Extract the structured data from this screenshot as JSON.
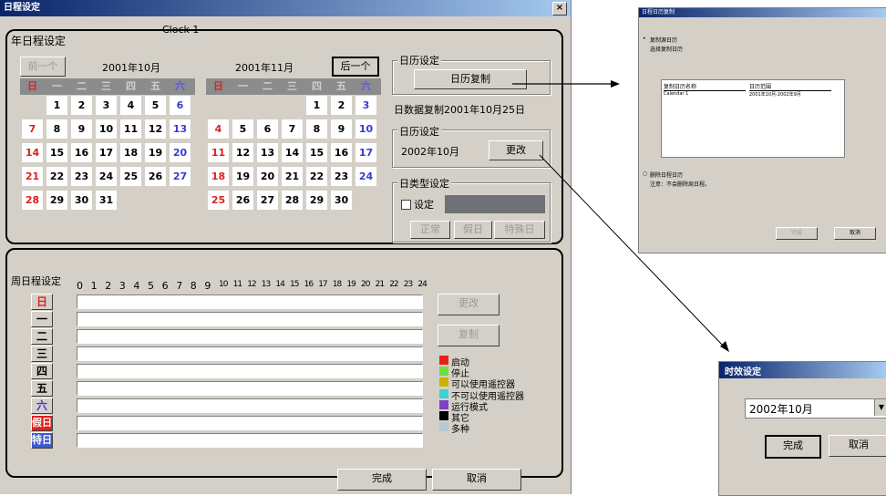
{
  "main_window": {
    "title": "日程设定",
    "close_glyph": "×",
    "clock_label": "Clock 1",
    "annual_section": {
      "label": "年日程设定",
      "prev_button": "前一个",
      "next_button": "后一个",
      "left_month_title": "2001年10月",
      "right_month_title": "2001年11月",
      "weekday_headers": [
        "日",
        "一",
        "二",
        "三",
        "四",
        "五",
        "六"
      ],
      "left_weeks": [
        [
          "",
          "1",
          "2",
          "3",
          "4",
          "5",
          "6"
        ],
        [
          "7",
          "8",
          "9",
          "10",
          "11",
          "12",
          "13"
        ],
        [
          "14",
          "15",
          "16",
          "17",
          "18",
          "19",
          "20"
        ],
        [
          "21",
          "22",
          "23",
          "24",
          "25",
          "26",
          "27"
        ],
        [
          "28",
          "29",
          "30",
          "31",
          "",
          "",
          ""
        ]
      ],
      "right_weeks": [
        [
          "",
          "",
          "",
          "",
          "1",
          "2",
          "3"
        ],
        [
          "4",
          "5",
          "6",
          "7",
          "8",
          "9",
          "10"
        ],
        [
          "11",
          "12",
          "13",
          "14",
          "15",
          "16",
          "17"
        ],
        [
          "18",
          "19",
          "20",
          "21",
          "22",
          "23",
          "24"
        ],
        [
          "25",
          "26",
          "27",
          "28",
          "29",
          "30",
          ""
        ]
      ]
    },
    "calendar_settings": {
      "group_label": "日历设定",
      "copy_button": "日历复制",
      "copy_status": "日数据复制2001年10月25日"
    },
    "calendar_setting2": {
      "group_label": "日历设定",
      "month_value": "2002年10月",
      "change_button": "更改"
    },
    "daytype_settings": {
      "group_label": "日类型设定",
      "checkbox_label": "设定",
      "normal_button": "正常",
      "holiday_button": "假日",
      "special_button": "特殊日"
    },
    "weekly_section": {
      "label": "周日程设定",
      "hours": [
        "0",
        "1",
        "2",
        "3",
        "4",
        "5",
        "6",
        "7",
        "8",
        "9",
        "10",
        "11",
        "12",
        "13",
        "14",
        "15",
        "16",
        "17",
        "18",
        "19",
        "20",
        "21",
        "22",
        "23",
        "24"
      ],
      "rows": [
        "日",
        "一",
        "二",
        "三",
        "四",
        "五",
        "六",
        "假日",
        "特日"
      ],
      "change_button": "更改",
      "copy_button": "复制",
      "legend": [
        {
          "label": "启动",
          "color": "#e8201c"
        },
        {
          "label": "停止",
          "color": "#6ce040"
        },
        {
          "label": "可以使用遥控器",
          "color": "#c8b400"
        },
        {
          "label": "不可以使用遥控器",
          "color": "#40d0d0"
        },
        {
          "label": "运行模式",
          "color": "#8040c8"
        },
        {
          "label": "其它",
          "color": "#000000"
        },
        {
          "label": "多种",
          "color": "#b8c8d0"
        }
      ]
    },
    "footer": {
      "ok_button": "完成",
      "cancel_button": "取消"
    }
  },
  "copy_dialog": {
    "title": "日程日历复制",
    "option1": "复制源日历",
    "option1_sub": "选择复制日历",
    "table_headers": [
      "复制日历名称",
      "日历范围"
    ],
    "table_row": [
      "Calendar 1",
      "2001年10月-2002年9月"
    ],
    "option2": "删除日程日历",
    "option2_note": "注意：不会删除周日程。",
    "ok_button": "完成",
    "cancel_button": "取消"
  },
  "time_dialog": {
    "title": "时效设定",
    "value": "2002年10月",
    "ok_button": "完成",
    "cancel_button": "取消"
  }
}
